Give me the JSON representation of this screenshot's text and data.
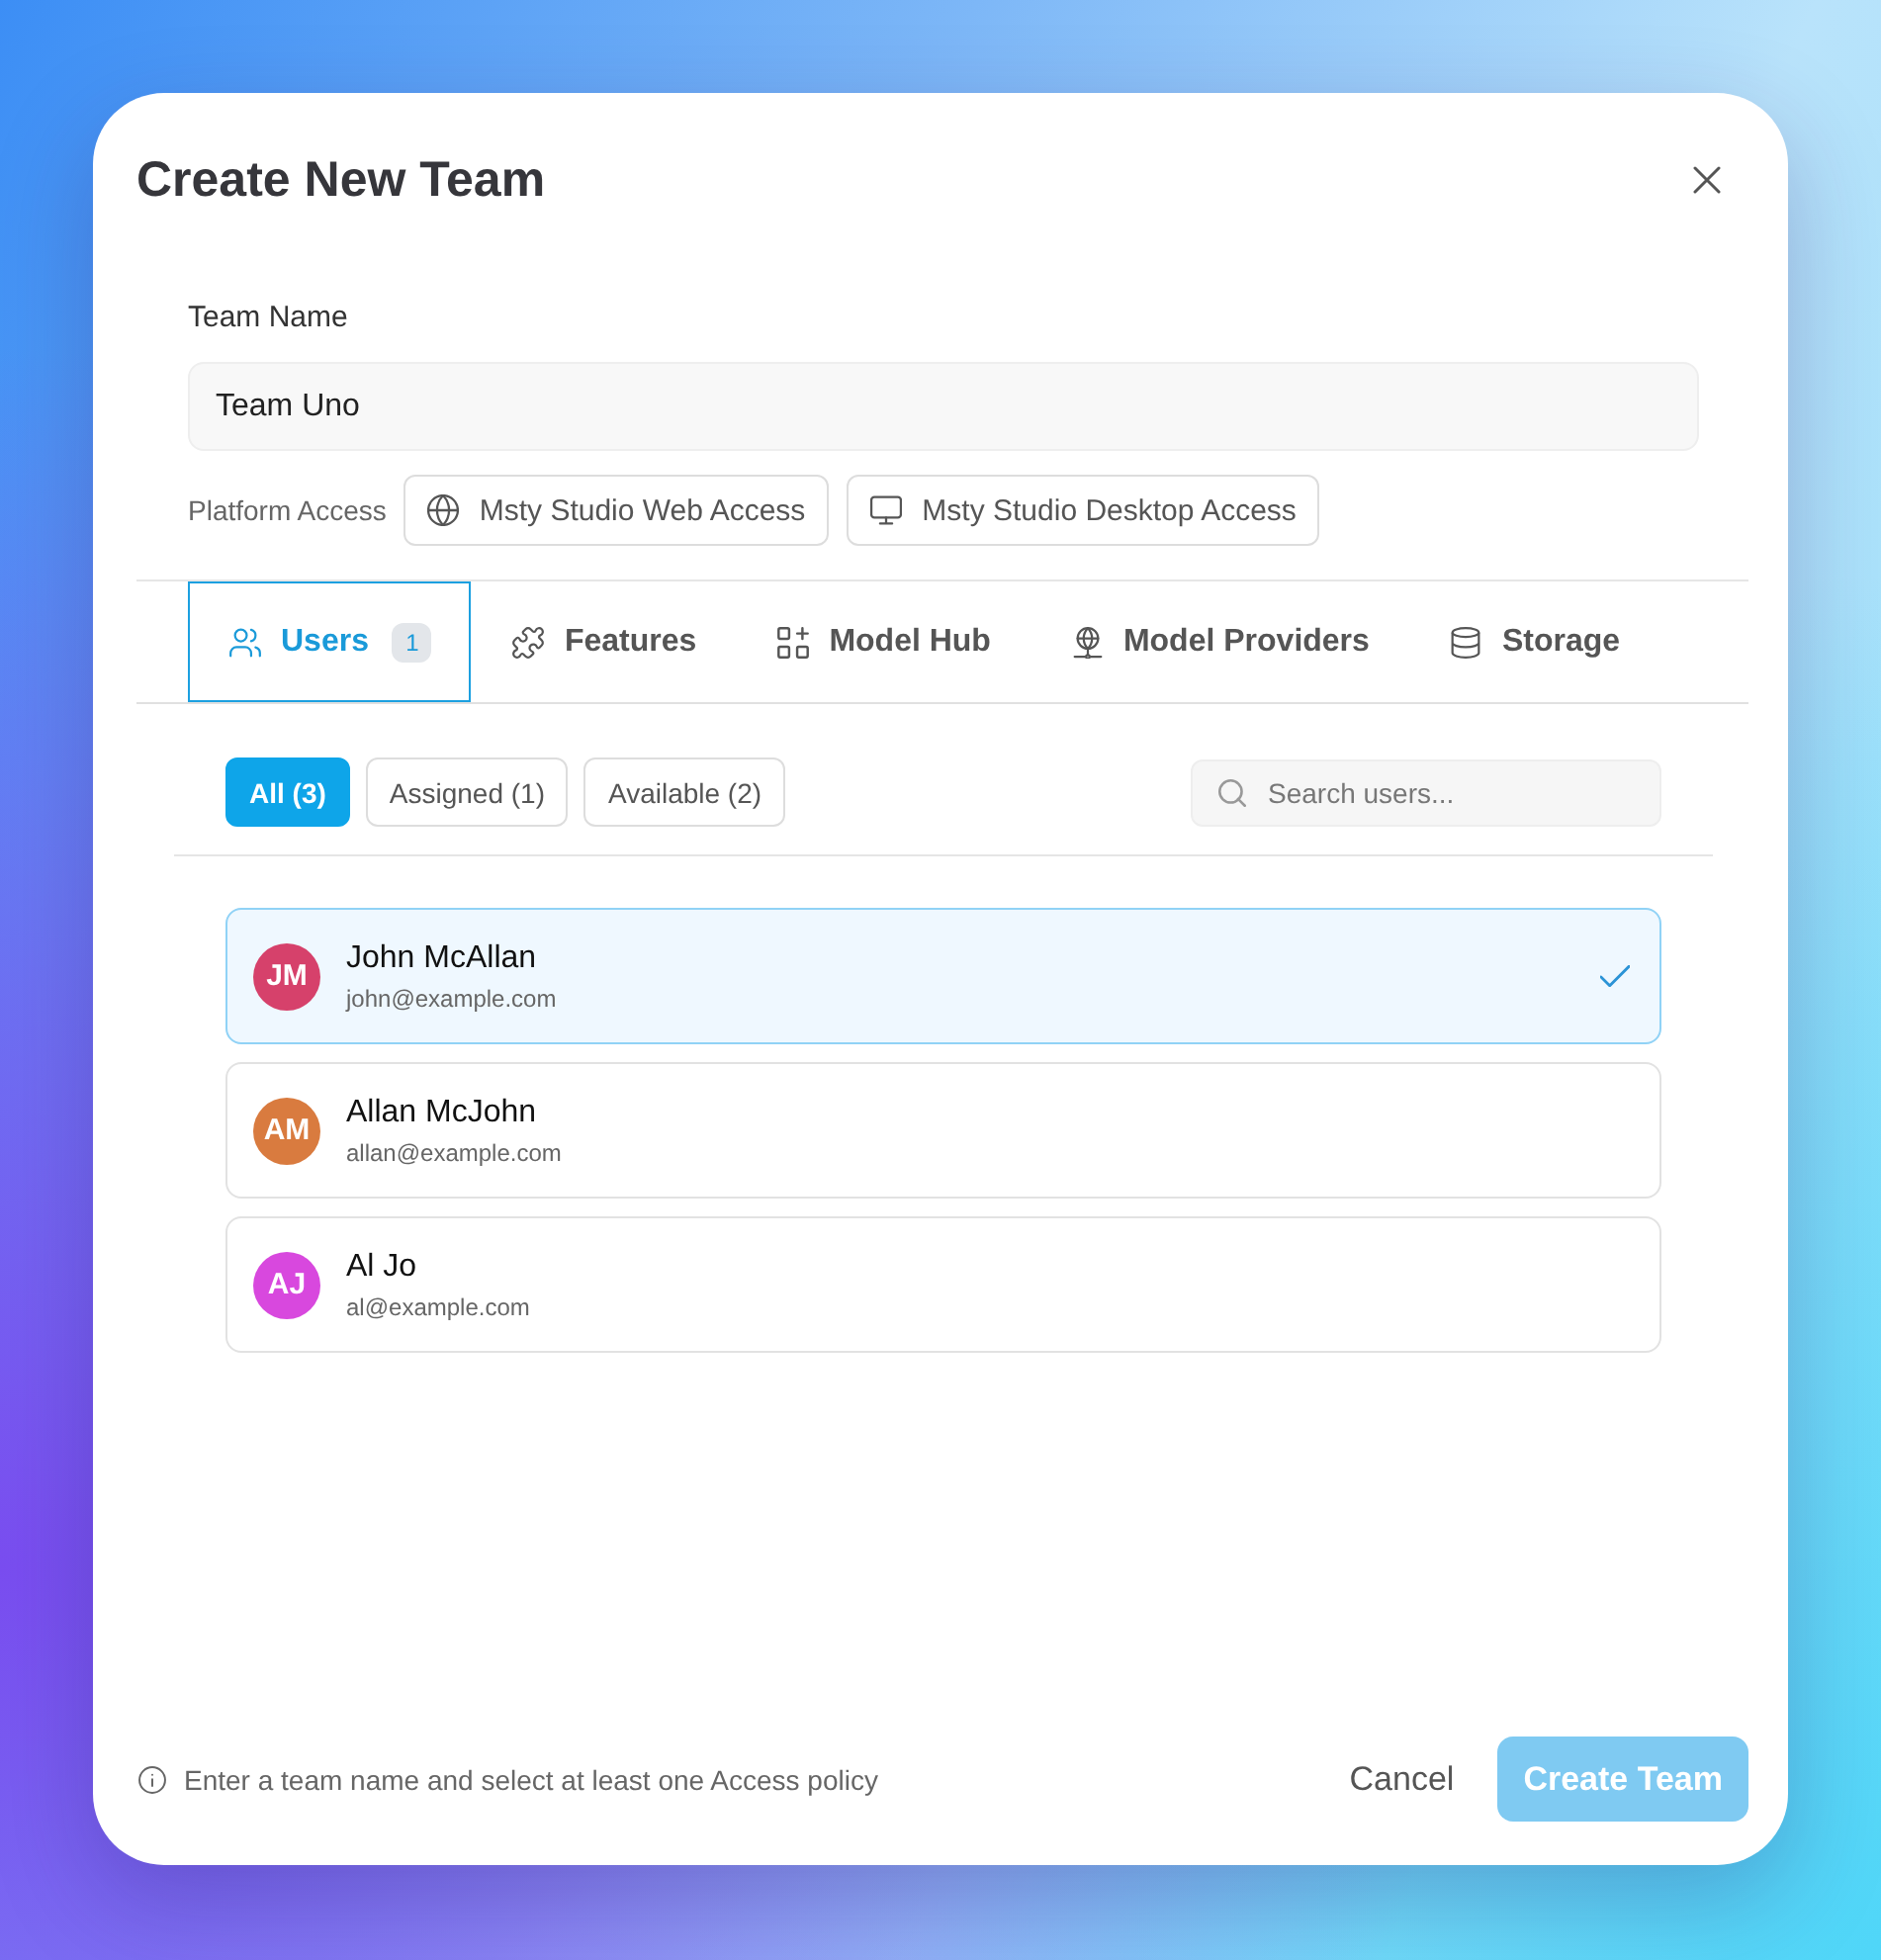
{
  "dialog": {
    "title": "Create New Team"
  },
  "team_name": {
    "label": "Team Name",
    "value": "Team Uno"
  },
  "platform_access": {
    "label": "Platform Access",
    "options": [
      {
        "kind": "web",
        "label": "Msty Studio Web Access",
        "selected": false
      },
      {
        "kind": "desktop",
        "label": "Msty Studio Desktop Access",
        "selected": false
      }
    ]
  },
  "tabs": [
    {
      "kind": "users",
      "label": "Users",
      "badge": "1",
      "selected": true
    },
    {
      "kind": "features",
      "label": "Features",
      "selected": false
    },
    {
      "kind": "model_hub",
      "label": "Model Hub",
      "selected": false
    },
    {
      "kind": "model_providers",
      "label": "Model Providers",
      "selected": false
    },
    {
      "kind": "storage",
      "label": "Storage",
      "selected": false
    }
  ],
  "filters": [
    {
      "label": "All (3)",
      "selected": true
    },
    {
      "label": "Assigned (1)",
      "selected": false
    },
    {
      "label": "Available (2)",
      "selected": false
    }
  ],
  "search": {
    "placeholder": "Search users..."
  },
  "users": [
    {
      "initials": "JM",
      "name": "John McAllan",
      "email": "john@example.com",
      "color": "#d6416b",
      "selected": true
    },
    {
      "initials": "AM",
      "name": "Allan McJohn",
      "email": "allan@example.com",
      "color": "#d97b3f",
      "selected": false
    },
    {
      "initials": "AJ",
      "name": "Al Jo",
      "email": "al@example.com",
      "color": "#d848de",
      "selected": false
    }
  ],
  "footer": {
    "hint": "Enter a team name and select at least one Access policy",
    "buttons": [
      {
        "kind": "cancel",
        "label": "Cancel",
        "disabled": false
      },
      {
        "kind": "primary",
        "label": "Create Team",
        "disabled": true
      }
    ]
  }
}
